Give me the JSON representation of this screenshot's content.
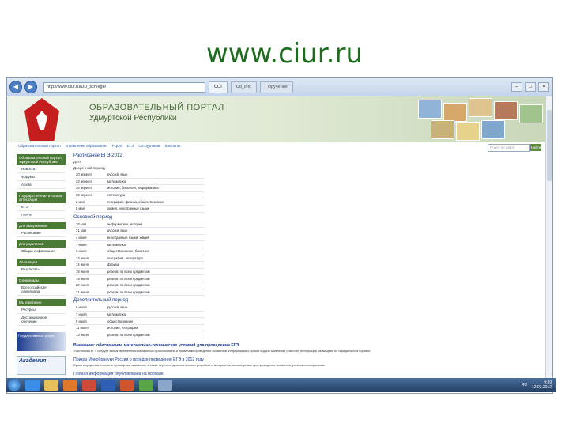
{
  "slide": {
    "title": "www.ciur.ru"
  },
  "browser": {
    "address": "http://www.ciur.ru/UD_sch/ege/",
    "tabs": [
      "UOI",
      "Ud_Info",
      "Поручение"
    ],
    "min": "–",
    "max": "□",
    "close": "×"
  },
  "site": {
    "title": "ОБРАЗОВАТЕЛЬНЫЙ ПОРТАЛ",
    "subtitle": "Удмуртской Республики",
    "top_links": [
      "Образовательный портал",
      "Управление образования",
      "РЦОИ",
      "ЕГЭ",
      "Сотрудникам",
      "Контакты"
    ],
    "search_placeholder": "Поиск по сайту",
    "search_button": "Найти"
  },
  "sidebar": {
    "sections": [
      {
        "head": "Образовательный портал Удмуртской Республики",
        "items": [
          "Новости",
          "Форумы",
          "Архив"
        ]
      },
      {
        "head": "Государственная итоговая аттестация",
        "items": [
          "ЕГЭ",
          "ГИА-9"
        ]
      },
      {
        "head": "Для выпускников",
        "items": [
          "Расписание"
        ]
      },
      {
        "head": "Для родителей",
        "items": [
          "Общая информация"
        ]
      },
      {
        "head": "Апелляции",
        "items": [
          "Результаты"
        ]
      },
      {
        "head": "Олимпиады",
        "items": [
          "Всероссийская олимпиада"
        ]
      },
      {
        "head": "Мы в регионе",
        "items": [
          "Ресурсы",
          "Дистанционное обучение"
        ]
      }
    ],
    "banner1": "Государственные услуги",
    "banner2": "Академия"
  },
  "main": {
    "schedule_title": "Расписание ЕГЭ-2012",
    "col_date": "Дата",
    "period1_label": "Досрочный период",
    "period1": [
      [
        "20 апреля",
        "русский язык"
      ],
      [
        "23 апреля",
        "математика"
      ],
      [
        "26 апреля",
        "история, биология, информатика"
      ],
      [
        "28 апреля",
        "литература"
      ],
      [
        "2 мая",
        "география, физика, обществознание"
      ],
      [
        "5 мая",
        "химия, иностранные языки"
      ]
    ],
    "period2_label": "Основной период",
    "period2": [
      [
        "28 мая",
        "информатика, история"
      ],
      [
        "31 мая",
        "русский язык"
      ],
      [
        "4 июня",
        "иностранные языки, химия"
      ],
      [
        "7 июня",
        "математика"
      ],
      [
        "9 июня",
        "обществознание, биология"
      ],
      [
        "13 июня",
        "география, литература"
      ],
      [
        "14 июня",
        "физика"
      ],
      [
        "18 июня",
        "резерв: по всем предметам"
      ],
      [
        "19 июня",
        "резерв: по всем предметам"
      ],
      [
        "20 июня",
        "резерв: по всем предметам"
      ],
      [
        "21 июня",
        "резерв: по всем предметам"
      ]
    ],
    "period3_label": "Дополнительный период",
    "period3": [
      [
        "5 июля",
        "русский язык"
      ],
      [
        "7 июля",
        "математика"
      ],
      [
        "9 июля",
        "обществознание"
      ],
      [
        "11 июля",
        "история, география"
      ],
      [
        "13 июля",
        "резерв: по всем предметам"
      ]
    ],
    "notice1_title": "Внимание: обеспечение материально-технических условий для проведения ЕГЭ",
    "notice1_text": "Участникам ЕГЭ следует заблаговременно ознакомиться с расписанием и правилами проведения экзаменов. Информация о сроках подачи заявлений и местах регистрации размещена на официальном портале.",
    "notice2_title": "Приказ Минобрнауки России о порядке проведения ЕГЭ в 2012 году",
    "notice2_text": "Сроки и продолжительность проведения экзаменов, а также перечень дополнительных устройств и материалов, используемых при проведении экзаменов, установлены приказом.",
    "notice3_title": "Полная информация опубликована на портале."
  },
  "taskbar": {
    "lang": "RU",
    "time": "9:39",
    "date": "12.03.2012"
  },
  "colors": {
    "accent": "#1f6b1f",
    "link": "#1a3c8f",
    "sidebar": "#4b7a36"
  }
}
